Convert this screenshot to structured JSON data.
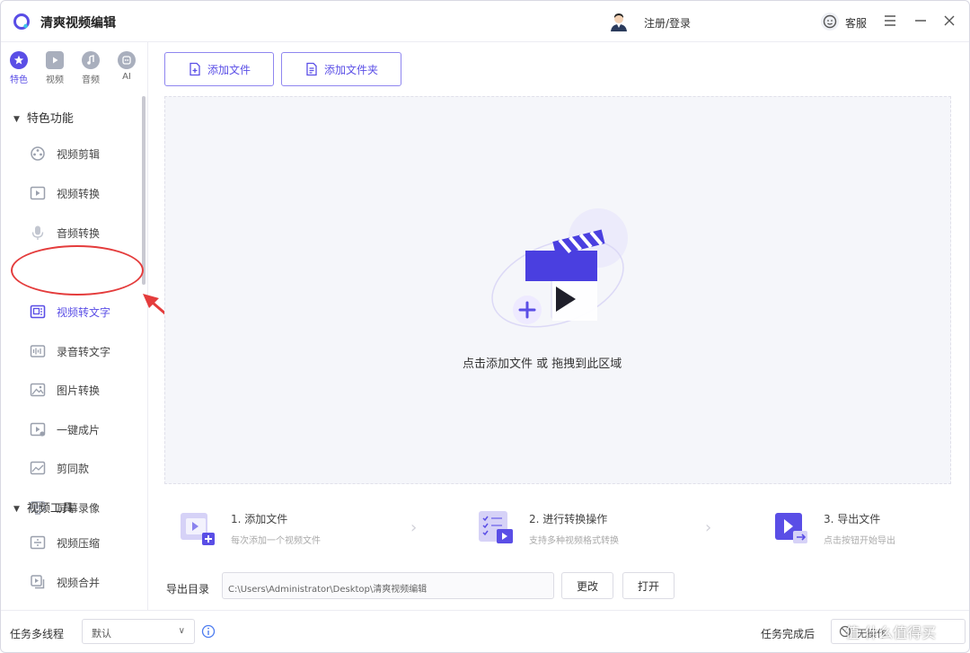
{
  "app": {
    "title": "清爽视频编辑",
    "login": "注册/登录",
    "service": "客服"
  },
  "categories": [
    {
      "label": "特色",
      "active": true
    },
    {
      "label": "视频",
      "active": false
    },
    {
      "label": "音频",
      "active": false
    },
    {
      "label": "AI",
      "active": false
    }
  ],
  "sidebar": {
    "group1": "特色功能",
    "group2": "视频工具",
    "items": [
      {
        "label": "视频剪辑",
        "icon": "video-edit-icon"
      },
      {
        "label": "视频转换",
        "icon": "video-convert-icon"
      },
      {
        "label": "音频转换",
        "icon": "microphone-icon"
      },
      {
        "label": "视频转文字",
        "icon": "video-to-text-icon"
      },
      {
        "label": "录音转文字",
        "icon": "audio-to-text-icon"
      },
      {
        "label": "图片转换",
        "icon": "image-convert-icon"
      },
      {
        "label": "一键成片",
        "icon": "one-click-film-icon"
      },
      {
        "label": "剪同款",
        "icon": "template-icon"
      },
      {
        "label": "屏幕录像",
        "icon": "screen-record-icon"
      }
    ],
    "tools": [
      {
        "label": "视频压缩",
        "icon": "video-compress-icon"
      },
      {
        "label": "视频合并",
        "icon": "video-merge-icon"
      }
    ]
  },
  "toolbar": {
    "add_file": "添加文件",
    "add_folder": "添加文件夹"
  },
  "dropzone": {
    "hint": "点击添加文件 或 拖拽到此区域"
  },
  "steps": [
    {
      "title": "1. 添加文件",
      "desc": "每次添加一个视频文件"
    },
    {
      "title": "2. 进行转换操作",
      "desc": "支持多种视频格式转换"
    },
    {
      "title": "3. 导出文件",
      "desc": "点击按钮开始导出"
    }
  ],
  "output": {
    "label": "导出目录",
    "path": "C:\\Users\\Administrator\\Desktop\\清爽视频编辑",
    "change": "更改",
    "open": "打开"
  },
  "bottom": {
    "threads_label": "任务多线程",
    "threads_value": "默认",
    "after_label": "任务完成后",
    "after_value": "无操作"
  },
  "watermark": "值 什么值得买",
  "colors": {
    "accent": "#5a4ee6",
    "annotation": "#e43c3c"
  }
}
